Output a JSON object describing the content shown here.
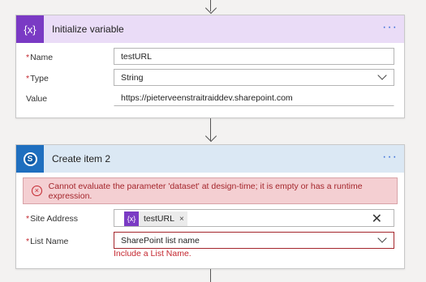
{
  "colors": {
    "variable_accent": "#7a3ac4",
    "variable_header_bg": "#eadcf7",
    "sharepoint_accent": "#1f6fbf",
    "sharepoint_header_bg": "#dbe8f4",
    "error_bg": "#f4cfd2",
    "error_text": "#a4262c",
    "more_dots": "#3a6fd8"
  },
  "icons": {
    "variable": "curly-braces-x-icon",
    "sharepoint": "sharepoint-s-icon",
    "more": "ellipsis-icon",
    "error": "circle-x-icon",
    "chevron": "chevron-down-icon",
    "clear": "close-icon"
  },
  "init_variable": {
    "icon_text": "{x}",
    "title": "Initialize variable",
    "more": "···",
    "fields": {
      "name": {
        "required": "*",
        "label": "Name",
        "value": "testURL"
      },
      "type": {
        "required": "*",
        "label": "Type",
        "value": "String"
      },
      "value": {
        "label": "Value",
        "value": "https://pieterveenstraitraiddev.sharepoint.com"
      }
    }
  },
  "create_item": {
    "icon_text": "S",
    "title": "Create item 2",
    "more": "···",
    "error_message": "Cannot evaluate the parameter 'dataset' at design-time; it is empty or has a runtime expression.",
    "error_icon": "×",
    "fields": {
      "site_address": {
        "required": "*",
        "label": "Site Address",
        "token_icon": "{x}",
        "token": "testURL",
        "token_remove": "×",
        "clear": "✕"
      },
      "list_name": {
        "required": "*",
        "label": "List Name",
        "value": "SharePoint list name",
        "hint": "Include a List Name."
      }
    }
  }
}
